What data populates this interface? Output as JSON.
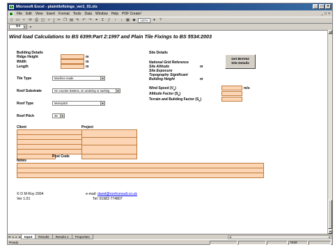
{
  "window": {
    "title": "Microsoft Excel - plaintilefixings_ver1_01.xls"
  },
  "menubar": {
    "items": [
      "File",
      "Edit",
      "View",
      "Insert",
      "Format",
      "Tools",
      "Data",
      "Window",
      "Help",
      "PDF Create!"
    ]
  },
  "toolbar": {
    "zoom": "100%"
  },
  "namebox": {
    "value": "B4"
  },
  "sheet": {
    "title": "Wind load Calculations to BS 6399:Part 2:1997 and Plain Tile Fixings to BS 5534:2003",
    "building_details": {
      "heading": "Building Details",
      "rows": [
        {
          "label": "Ridge Height",
          "unit": "m"
        },
        {
          "label": "Width",
          "unit": "m"
        },
        {
          "label": "Length",
          "unit": "m"
        }
      ]
    },
    "tile_type": {
      "label": "Tile Type",
      "value": "Machine made"
    },
    "roof_substrate": {
      "label": "Roof Substrate",
      "value": "On counter battens, on underlay or sarking"
    },
    "roof_type": {
      "label": "Roof Type",
      "value": "Monopitch"
    },
    "roof_pitch": {
      "label": "Roof Pitch",
      "value": "35"
    },
    "site_details": {
      "heading": "Site Details",
      "national_grid": "National Grid Reference",
      "site_altitude": "Site Altitude",
      "site_altitude_unit": "m",
      "site_exposure": "Site Exposure",
      "topography": "Topography Significant",
      "building_height": "Building Height",
      "building_height_unit": "m"
    },
    "get_button": {
      "line1": "Get BreVe2",
      "line2": "Site Details"
    },
    "wind_speed": {
      "label": "Wind Speed (V",
      "sub": "b",
      "suffix": ")",
      "unit": "m/s"
    },
    "altitude_factor": {
      "label": "Altitude Factor (S",
      "sub": "a",
      "suffix": ")"
    },
    "terrain_factor": {
      "label": "Terrain and Building Factor (S",
      "sub": "b",
      "suffix": ")"
    },
    "client": {
      "label": "Client"
    },
    "project": {
      "label": "Project"
    },
    "post_code": {
      "label": "Post Code"
    },
    "notes": {
      "label": "Notes"
    },
    "footer": {
      "copyright": "© D M Roy 2004",
      "version": "Ver 1.01",
      "email_label": "e-mail:",
      "email": "david@roofconsult.co.uk",
      "tel": "Tel: 01983 774807"
    }
  },
  "tabs": [
    {
      "label": "Input",
      "active": true
    },
    {
      "label": "Results",
      "active": false
    },
    {
      "label": "Results 1",
      "active": false
    },
    {
      "label": "Properties",
      "active": false
    }
  ],
  "status": {
    "text": "Ready",
    "num": "NUM"
  }
}
